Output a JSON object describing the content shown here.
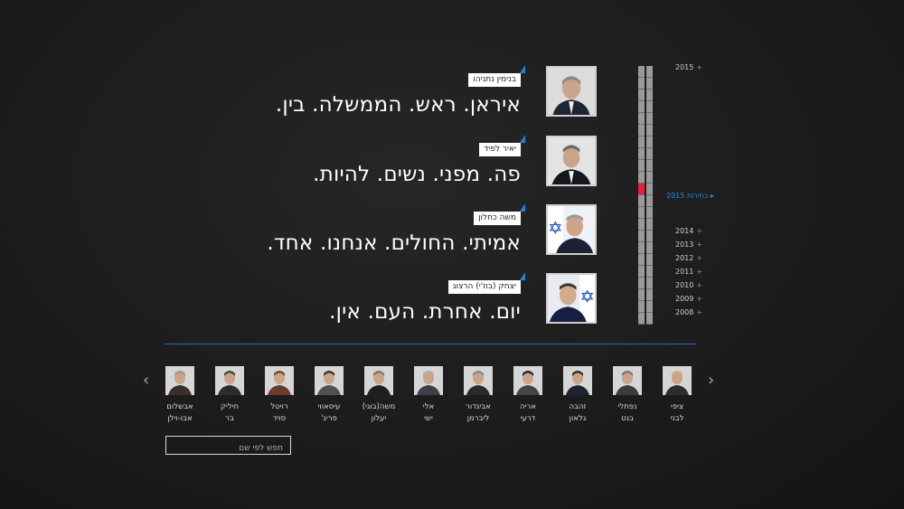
{
  "cards": [
    {
      "name": "בנימין נתניהו",
      "quote": "איראן. ראש. הממשלה. בין."
    },
    {
      "name": "יאיר לפיד",
      "quote": "פה. מפני. נשים. להיות."
    },
    {
      "name": "משה כחלון",
      "quote": "אמיתי. החולים. אנחנו. אחד."
    },
    {
      "name": "יצחק (בוז'י) הרצוג",
      "quote": "יום. אחרת. העם. אין."
    }
  ],
  "timeline": {
    "top_year": "2015",
    "election_label": "בחירות 2015",
    "years": [
      "2014",
      "2013",
      "2012",
      "2011",
      "2010",
      "2009",
      "2008"
    ],
    "highlight_color": "#e8213a",
    "accent_color": "#2a8be0"
  },
  "politicians": [
    {
      "first": "ציפי",
      "last": "לבני"
    },
    {
      "first": "נפתלי",
      "last": "בנט"
    },
    {
      "first": "זהבה",
      "last": "גלאון"
    },
    {
      "first": "אריה",
      "last": "דרעי"
    },
    {
      "first": "אביגדור",
      "last": "ליברמן"
    },
    {
      "first": "אלי",
      "last": "ישי"
    },
    {
      "first": "משה(בוגי)",
      "last": "יעלון"
    },
    {
      "first": "עיסאווי",
      "last": "פריג'"
    },
    {
      "first": "רויטל",
      "last": "סויד"
    },
    {
      "first": "חיליק",
      "last": "בר"
    },
    {
      "first": "אבשלום",
      "last": "אבו-וילן"
    }
  ],
  "nav": {
    "prev_icon": "chevron-left-icon",
    "next_icon": "chevron-right-icon"
  },
  "search": {
    "placeholder": "חפש לפי שם"
  }
}
